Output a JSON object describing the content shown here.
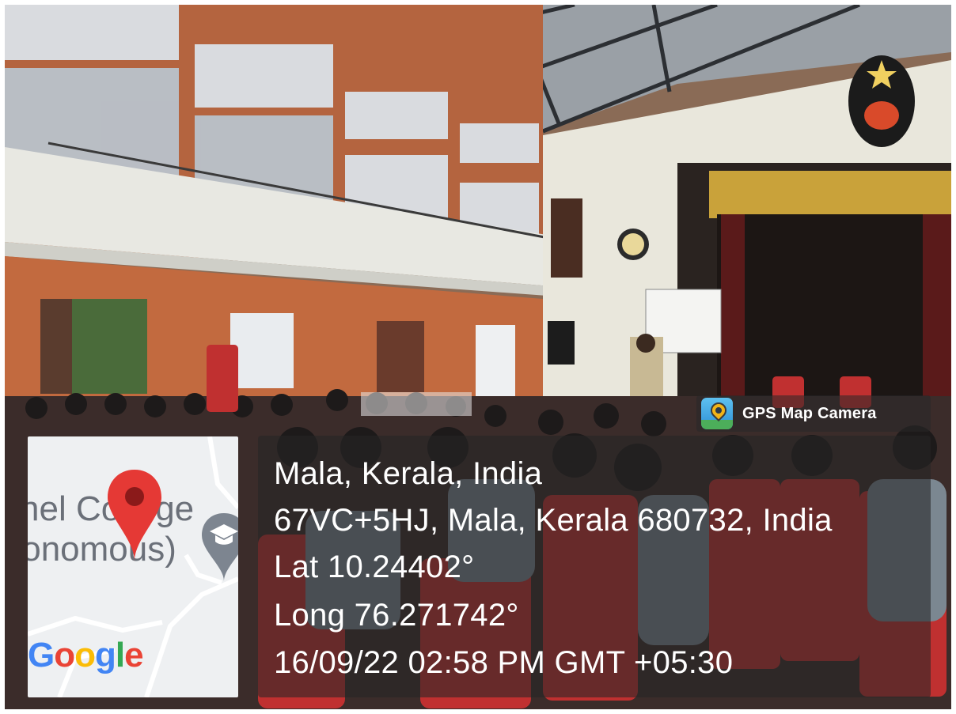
{
  "badge": {
    "label": "GPS Map Camera",
    "icon": "gps-map-camera-app-icon",
    "icon_colors": [
      "#5ec1f0",
      "#f2b418",
      "#4cae5a"
    ]
  },
  "location": {
    "place": "Mala, Kerala, India",
    "address": "67VC+5HJ, Mala, Kerala 680732, India",
    "latitude": "Lat 10.24402°",
    "longitude": "Long 76.271742°",
    "datetime": "16/09/22 02:58 PM GMT +05:30"
  },
  "map": {
    "label_line1": "hel College",
    "label_line2": "tonomous)",
    "pin_icon": "red-location-pin-icon",
    "pin_color": "#e53935",
    "poi_icon": "graduation-cap-icon",
    "logo": "Google",
    "logo_letters": [
      "G",
      "o",
      "o",
      "g",
      "l",
      "e"
    ],
    "logo_colors": [
      "#4285f4",
      "#ea4335",
      "#fbbc05",
      "#4285f4",
      "#34a853",
      "#ea4335"
    ]
  }
}
